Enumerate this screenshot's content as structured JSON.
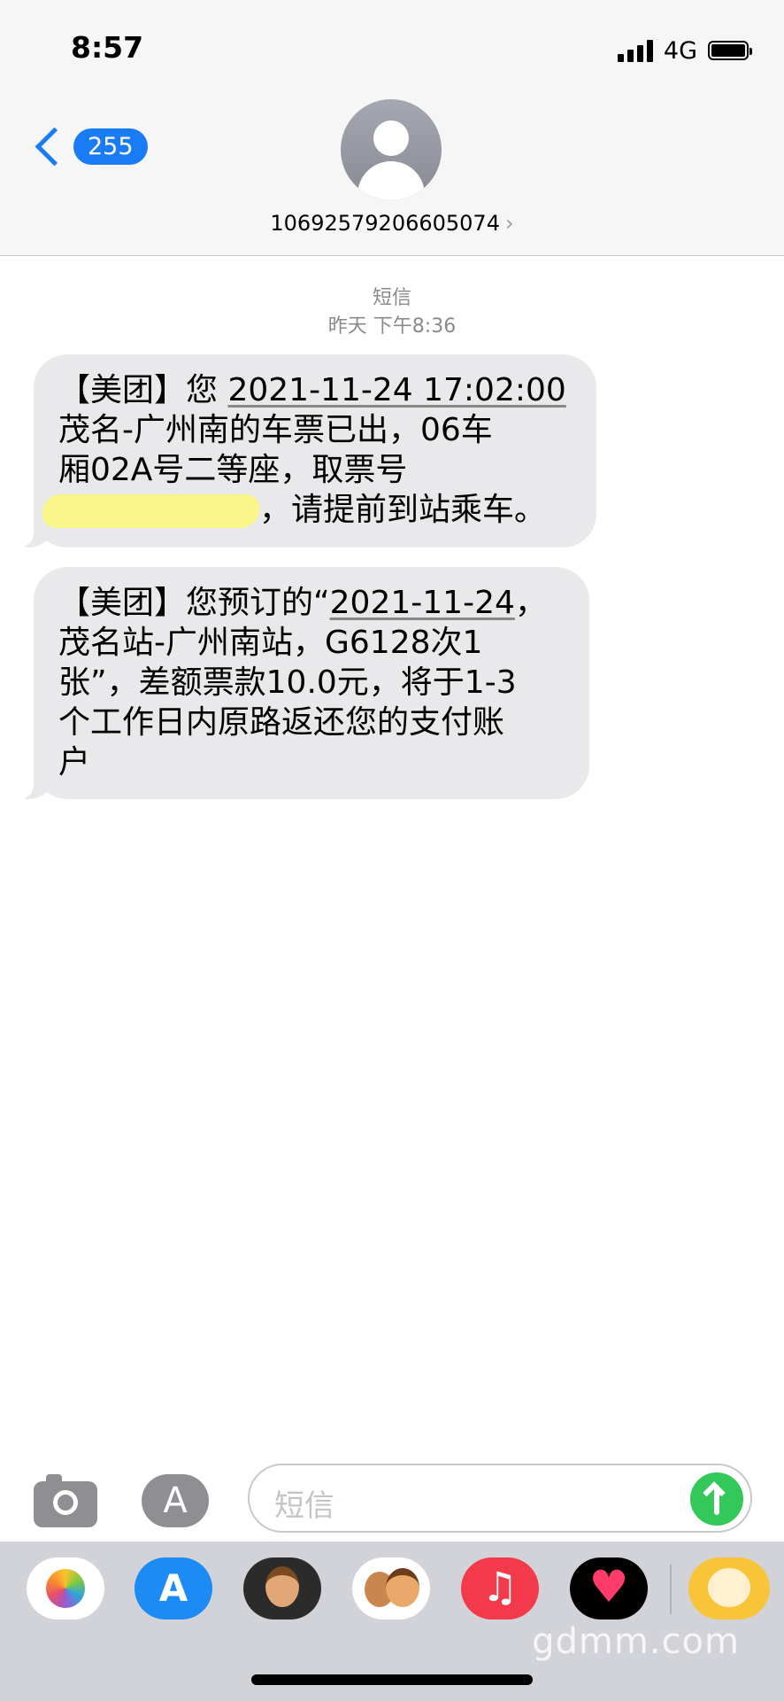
{
  "status_bar": {
    "time": "8:57",
    "network": "4G",
    "signal_level": 4,
    "battery_level": 1.0
  },
  "header": {
    "back_badge": "255",
    "contact": "10692579206605074",
    "contact_chevron": "›",
    "avatar_icon": "person-avatar-icon"
  },
  "conversation": {
    "service": "短信",
    "timestamp": "昨天 下午8:36",
    "message1": {
      "prefix": "【美团】您 ",
      "datetime": "2021-11-24 17:02:00",
      "line2": "茂名-广州南的车票已出，06车",
      "line3": "厢02A号二等座，取票号",
      "line4_tail": "，请提前到站乘车。"
    },
    "message2": {
      "prefix": "【美团】您预订的“",
      "date": "2021-11-24",
      "line1_tail": "，",
      "line2": "茂名站-广州南站，G6128次1",
      "line3": "张”，差额票款10.0元，将于1-3",
      "line4": "个工作日内原路返还您的支付账",
      "line5": "户"
    }
  },
  "input": {
    "placeholder": "短信",
    "camera_icon": "camera-icon",
    "apps_icon": "app-store-icon",
    "send_icon": "send-arrow-icon",
    "send_color": "#34c759"
  },
  "drawer": {
    "apps": [
      "photos-icon",
      "app-store-icon",
      "memoji-icon",
      "memoji-stickers-icon",
      "music-icon",
      "heart-icon",
      "game-icon"
    ]
  },
  "watermark": "gdmm.com",
  "colors": {
    "accent": "#1a7cf5",
    "bubble": "#e9e9eb",
    "redaction": "#fbf68a"
  }
}
